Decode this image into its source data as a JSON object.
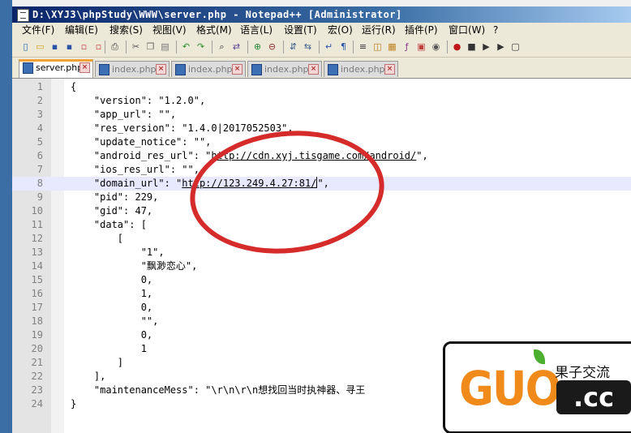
{
  "window": {
    "title": "D:\\XYJ3\\phpStudy\\WWW\\server.php - Notepad++ [Administrator]"
  },
  "menu": [
    "文件(F)",
    "编辑(E)",
    "搜索(S)",
    "视图(V)",
    "格式(M)",
    "语言(L)",
    "设置(T)",
    "宏(O)",
    "运行(R)",
    "插件(P)",
    "窗口(W)",
    "?"
  ],
  "toolbar": {
    "icons": [
      "new-file-icon",
      "open-file-icon",
      "save-icon",
      "save-all-icon",
      "close-icon",
      "close-all-icon",
      "print-icon",
      "cut-icon",
      "copy-icon",
      "paste-icon",
      "undo-icon",
      "redo-icon",
      "find-icon",
      "replace-icon",
      "zoom-in-icon",
      "zoom-out-icon",
      "sync-v-icon",
      "sync-h-icon",
      "wrap-icon",
      "show-all-icon",
      "indent-guide-icon",
      "udl-icon",
      "doc-map-icon",
      "function-list-icon",
      "folder-workspace-icon",
      "monitor-icon",
      "record-icon",
      "stop-icon",
      "play-icon",
      "play-multi-icon",
      "save-macro-icon"
    ]
  },
  "tabs": [
    {
      "label": "server.php",
      "active": true
    },
    {
      "label": "index.php",
      "active": false
    },
    {
      "label": "index.php",
      "active": false
    },
    {
      "label": "index.php",
      "active": false
    },
    {
      "label": "index.php",
      "active": false
    }
  ],
  "editor": {
    "current_line": 8,
    "lines": [
      {
        "n": "1",
        "text": "{"
      },
      {
        "n": "2",
        "text": "    \"version\": \"1.2.0\","
      },
      {
        "n": "3",
        "text": "    \"app_url\": \"\","
      },
      {
        "n": "4",
        "text": "    \"res_version\": \"1.4.0|2017052503\","
      },
      {
        "n": "5",
        "text": "    \"update_notice\": \"\","
      },
      {
        "n": "6",
        "pre": "    \"android_res_url\": \"",
        "url": "http://cdn.xyj.tisgame.com/android/",
        "post": "\","
      },
      {
        "n": "7",
        "text": "    \"ios_res_url\": \"\","
      },
      {
        "n": "8",
        "pre": "    \"domain_url\": \"",
        "url": "http://123.249.4.27:81/",
        "post": "\","
      },
      {
        "n": "9",
        "text": "    \"pid\": 229,"
      },
      {
        "n": "10",
        "text": "    \"gid\": 47,"
      },
      {
        "n": "11",
        "text": "    \"data\": ["
      },
      {
        "n": "12",
        "text": "        ["
      },
      {
        "n": "13",
        "text": "            \"1\","
      },
      {
        "n": "14",
        "text": "            \"飘渺恋心\","
      },
      {
        "n": "15",
        "text": "            0,"
      },
      {
        "n": "16",
        "text": "            1,"
      },
      {
        "n": "17",
        "text": "            0,"
      },
      {
        "n": "18",
        "text": "            \"\","
      },
      {
        "n": "19",
        "text": "            0,"
      },
      {
        "n": "20",
        "text": "            1"
      },
      {
        "n": "21",
        "text": "        ]"
      },
      {
        "n": "22",
        "text": "    ],"
      },
      {
        "n": "23",
        "text": "    \"maintenanceMess\": \"\\r\\n\\r\\n想找回当时执神器、寻王"
      },
      {
        "n": "24",
        "text": "}"
      }
    ]
  },
  "watermark": {
    "brand": "GUO",
    "chinese": "果子交流",
    "domain": ".cc"
  },
  "colors": {
    "title_bar": "#0a246a",
    "annotation_circle": "#d62b2b",
    "watermark_orange": "#f08a1a",
    "active_tab_accent": "#f3a23a"
  }
}
